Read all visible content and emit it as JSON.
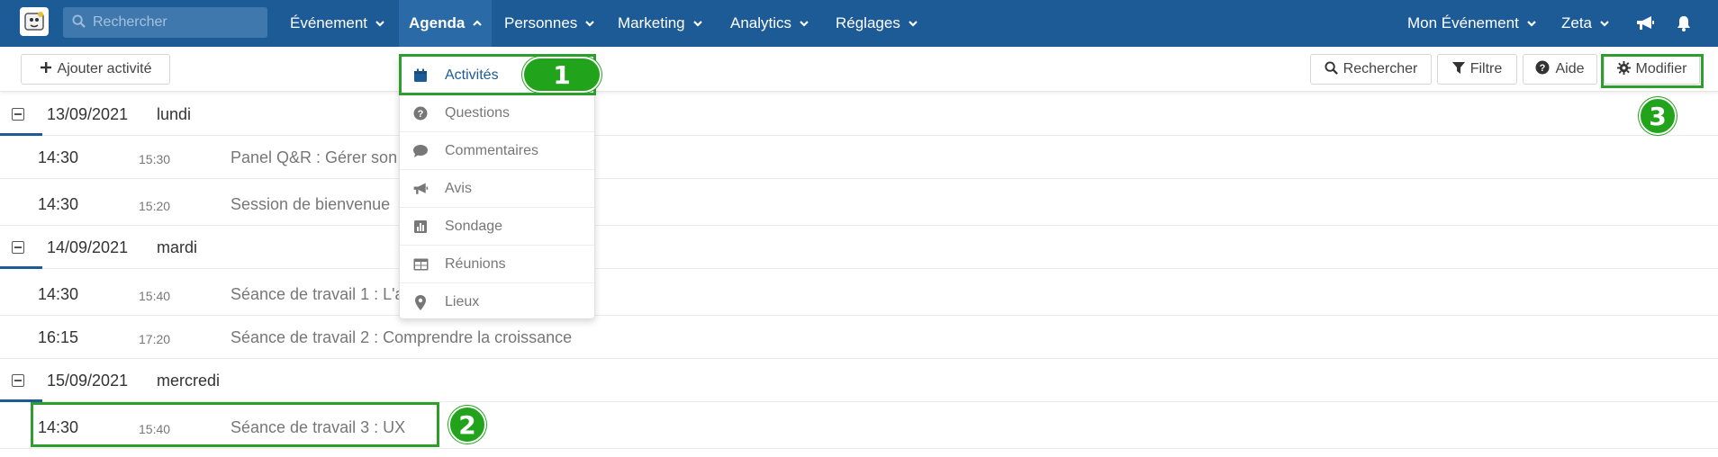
{
  "topnav": {
    "logo_icon": "app-logo",
    "search_placeholder": "Rechercher",
    "menus": [
      {
        "label": "Événement"
      },
      {
        "label": "Agenda"
      },
      {
        "label": "Personnes"
      },
      {
        "label": "Marketing"
      },
      {
        "label": "Analytics"
      },
      {
        "label": "Réglages"
      }
    ],
    "right": {
      "event_label": "Mon Événement",
      "user_label": "Zeta",
      "announce_icon": "bullhorn-icon",
      "bell_icon": "bell-icon"
    }
  },
  "toolbar": {
    "add_label": "Ajouter activité",
    "search_label": "Rechercher",
    "filter_label": "Filtre",
    "help_label": "Aide",
    "edit_label": "Modifier"
  },
  "dropdown": {
    "items": [
      {
        "label": "Activités",
        "icon": "calendar-icon"
      },
      {
        "label": "Questions",
        "icon": "question-circle-icon"
      },
      {
        "label": "Commentaires",
        "icon": "comment-icon"
      },
      {
        "label": "Avis",
        "icon": "bullhorn-icon"
      },
      {
        "label": "Sondage",
        "icon": "bar-chart-icon"
      },
      {
        "label": "Réunions",
        "icon": "table-icon"
      },
      {
        "label": "Lieux",
        "icon": "map-marker-icon"
      }
    ]
  },
  "agenda": {
    "days": [
      {
        "date": "13/09/2021",
        "weekday": "lundi",
        "activities": [
          {
            "start": "14:30",
            "end": "15:30",
            "title": "Panel Q&R : Gérer son"
          },
          {
            "start": "14:30",
            "end": "15:20",
            "title": "Session de bienvenue"
          }
        ]
      },
      {
        "date": "14/09/2021",
        "weekday": "mardi",
        "activities": [
          {
            "start": "14:30",
            "end": "15:40",
            "title": "Séance de travail 1 : L'a"
          },
          {
            "start": "16:15",
            "end": "17:20",
            "title": "Séance de travail 2 : Comprendre la croissance"
          }
        ]
      },
      {
        "date": "15/09/2021",
        "weekday": "mercredi",
        "activities": [
          {
            "start": "14:30",
            "end": "15:40",
            "title": "Séance de travail 3 : UX"
          }
        ]
      }
    ]
  },
  "annotations": {
    "badge1": "1",
    "badge2": "2",
    "badge3": "3"
  },
  "colors": {
    "nav_bg": "#1d5b96",
    "highlight": "#2e9e2e",
    "badge": "#22a31c"
  }
}
